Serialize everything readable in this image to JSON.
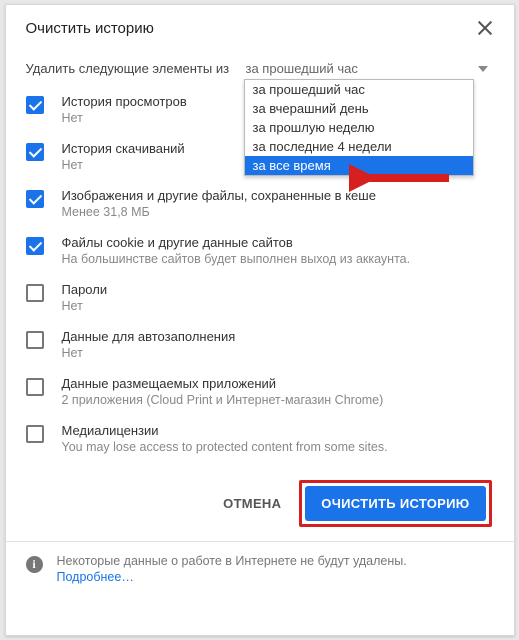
{
  "dialog": {
    "title": "Очистить историю",
    "range_label": "Удалить следующие элементы из",
    "range_selected": "за прошедший час"
  },
  "dropdown": {
    "options": [
      "за прошедший час",
      "за вчерашний день",
      "за прошлую неделю",
      "за последние 4 недели",
      "за все время"
    ],
    "highlighted_index": 4
  },
  "items": [
    {
      "checked": true,
      "label": "История просмотров",
      "sub": "Нет"
    },
    {
      "checked": true,
      "label": "История скачиваний",
      "sub": "Нет"
    },
    {
      "checked": true,
      "label": "Изображения и другие файлы, сохраненные в кеше",
      "sub": "Менее 31,8 МБ"
    },
    {
      "checked": true,
      "label": "Файлы cookie и другие данные сайтов",
      "sub": "На большинстве сайтов будет выполнен выход из аккаунта."
    },
    {
      "checked": false,
      "label": "Пароли",
      "sub": "Нет"
    },
    {
      "checked": false,
      "label": "Данные для автозаполнения",
      "sub": "Нет"
    },
    {
      "checked": false,
      "label": "Данные размещаемых приложений",
      "sub": "2 приложения (Cloud Print и Интернет-магазин Chrome)"
    },
    {
      "checked": false,
      "label": "Медиалицензии",
      "sub": "You may lose access to protected content from some sites."
    }
  ],
  "buttons": {
    "cancel": "ОТМЕНА",
    "confirm": "ОЧИСТИТЬ ИСТОРИЮ"
  },
  "footer": {
    "text": "Некоторые данные о работе в Интернете не будут удалены.",
    "link": "Подробнее…"
  }
}
